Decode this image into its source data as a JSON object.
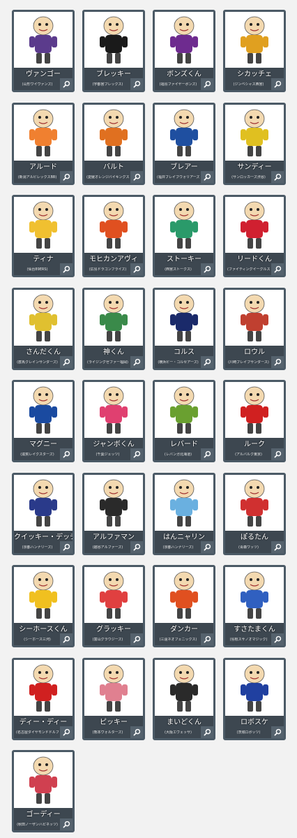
{
  "mascots": [
    {
      "name": "ヴァンゴー",
      "team": "(山形ワイヴァンズ)",
      "color": "#5b3b8c"
    },
    {
      "name": "ブレッキー",
      "team": "(宇都宮ブレックス)",
      "color": "#1a1a1a"
    },
    {
      "name": "ボンズくん",
      "team": "(福島ファイヤーボンズ)",
      "color": "#6e2b8f"
    },
    {
      "name": "シカッチェ",
      "team": "(ジンベシャス西宮)",
      "color": "#e0a020"
    },
    {
      "name": "アルード",
      "team": "(新潟アルビレックスBB)",
      "color": "#f08030"
    },
    {
      "name": "バルト",
      "team": "(愛媛オレンジバイキングス)",
      "color": "#e07020"
    },
    {
      "name": "ブレアー",
      "team": "(福井ブレイブウォリアーズ)",
      "color": "#1f4fa0"
    },
    {
      "name": "サンディー",
      "team": "(サンロッカーズ渋谷)",
      "color": "#e0c020"
    },
    {
      "name": "ティナ",
      "team": "(仙台89ERS)",
      "color": "#f0c030"
    },
    {
      "name": "モヒカンアヴィ",
      "team": "(広島ドラゴンフライズ)",
      "color": "#e05020"
    },
    {
      "name": "ストーキー",
      "team": "(西宮ストークス)",
      "color": "#2a9a6a"
    },
    {
      "name": "リードくん",
      "team": "(ファイティングイーグルス名古屋)",
      "color": "#d02030"
    },
    {
      "name": "さんだくん",
      "team": "(群馬クレインサンダーズ)",
      "color": "#e0c030"
    },
    {
      "name": "神くん",
      "team": "(ライジングゼファー福岡)",
      "color": "#3a8a4a"
    },
    {
      "name": "コルス",
      "team": "(横浜ビー・コルセアーズ)",
      "color": "#1a2a6a"
    },
    {
      "name": "ロウル",
      "team": "(川崎ブレイブサンダース)",
      "color": "#c04030"
    },
    {
      "name": "マグニー",
      "team": "(滋賀レイクスターズ)",
      "color": "#1a4aa0"
    },
    {
      "name": "ジャンボくん",
      "team": "(千葉ジェッツ)",
      "color": "#e04070"
    },
    {
      "name": "レバード",
      "team": "(レバンガ北海道)",
      "color": "#6aa030"
    },
    {
      "name": "ルーク",
      "team": "(アルバルク東京)",
      "color": "#d02020"
    },
    {
      "name": "クイッキー・デッチ",
      "team": "(京都ハンナリーズ)",
      "color": "#2a3a8a"
    },
    {
      "name": "アルファマン",
      "team": "(越谷アルファーズ)",
      "color": "#2a2a2a"
    },
    {
      "name": "はんニャリン",
      "team": "(京都ハンナリーズ)",
      "color": "#6ab0e0"
    },
    {
      "name": "ぽるたん",
      "team": "(青森ワッツ)",
      "color": "#d03030"
    },
    {
      "name": "シーホースくん",
      "team": "(シーホース三河)",
      "color": "#f0c020"
    },
    {
      "name": "グラッキー",
      "team": "(富山グラウジーズ)",
      "color": "#e04040"
    },
    {
      "name": "ダンカー",
      "team": "(三遠ネオフェニックス)",
      "color": "#e05020"
    },
    {
      "name": "すさたまくん",
      "team": "(島根スサノオマジック)",
      "color": "#3060c0"
    },
    {
      "name": "ディー・ディー",
      "team": "(名古屋ダイヤモンドドルフィンズ)",
      "color": "#d02020"
    },
    {
      "name": "ピッキー",
      "team": "(熊本ヴォルターズ)",
      "color": "#e08090"
    },
    {
      "name": "まいどくん",
      "team": "(大阪エヴェッサ)",
      "color": "#2a2a2a"
    },
    {
      "name": "ロボスケ",
      "team": "(茨城ロボッツ)",
      "color": "#2040a0"
    },
    {
      "name": "ゴーディー",
      "team": "(秋田ノーザンハピネッツ)",
      "color": "#d04050"
    }
  ],
  "icons": {
    "zoom": "magnifier-icon"
  }
}
